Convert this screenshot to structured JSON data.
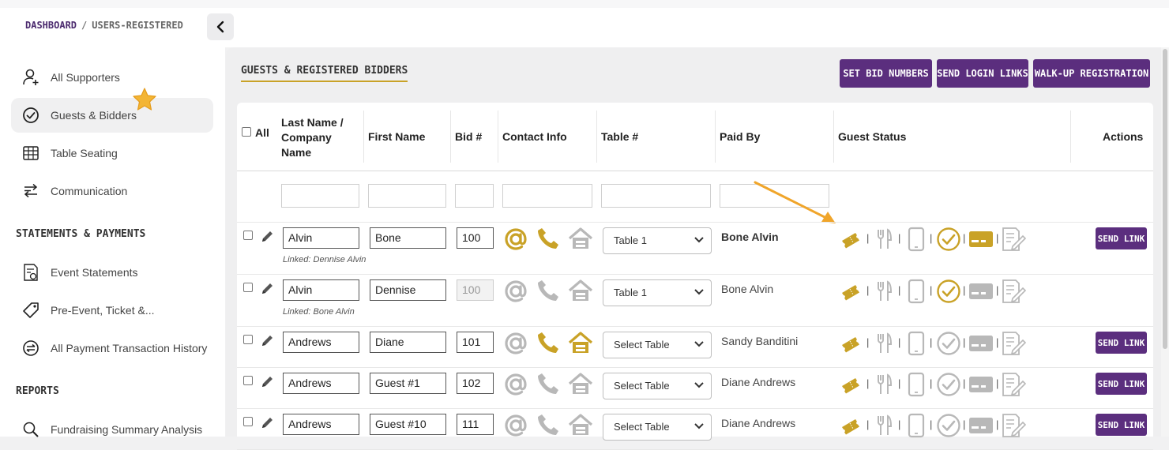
{
  "breadcrumb": {
    "home": "DASHBOARD",
    "separator": "/",
    "current": "USERS-REGISTERED"
  },
  "sidebar": {
    "items": [
      {
        "label": "All Supporters",
        "icon": "user-add-icon"
      },
      {
        "label": "Guests & Bidders",
        "icon": "check-circle-icon",
        "active": true
      },
      {
        "label": "Table Seating",
        "icon": "grid-icon"
      },
      {
        "label": "Communication",
        "icon": "arrows-icon"
      }
    ],
    "section_statements": "STATEMENTS & PAYMENTS",
    "statements_items": [
      {
        "label": "Event Statements",
        "icon": "statement-icon"
      },
      {
        "label": "Pre-Event, Ticket &...",
        "icon": "tag-icon"
      },
      {
        "label": "All Payment Transaction History",
        "icon": "exchange-icon"
      }
    ],
    "section_reports": "REPORTS",
    "reports_items": [
      {
        "label": "Fundraising Summary Analysis",
        "icon": "magnify-icon"
      }
    ]
  },
  "main": {
    "title": "GUESTS & REGISTERED BIDDERS",
    "buttons": {
      "set_bid": "SET BID NUMBERS",
      "send_login": "SEND LOGIN LINKS",
      "walk_up": "WALK-UP REGISTRATION"
    }
  },
  "table": {
    "headers": {
      "all": "All",
      "last_name": "Last Name / Company Name",
      "first_name": "First Name",
      "bid": "Bid #",
      "contact": "Contact Info",
      "table": "Table #",
      "paid_by": "Paid By",
      "guest_status": "Guest Status",
      "actions": "Actions"
    },
    "rows": [
      {
        "last": "Alvin",
        "first": "Bone",
        "bid": "100",
        "bid_disabled": false,
        "linked": "Linked: Dennise Alvin",
        "table": "Table 1",
        "paid_by": "Bone Alvin",
        "paid_bold": true,
        "email": true,
        "phone": true,
        "home": false,
        "checked_in": true,
        "card": true,
        "action": "SEND LINK"
      },
      {
        "last": "Alvin",
        "first": "Dennise",
        "bid": "100",
        "bid_disabled": true,
        "linked": "Linked: Bone Alvin",
        "table": "Table 1",
        "paid_by": "Bone Alvin",
        "paid_bold": false,
        "email": false,
        "phone": false,
        "home": false,
        "checked_in": true,
        "card": false,
        "action": ""
      },
      {
        "last": "Andrews",
        "first": "Diane",
        "bid": "101",
        "bid_disabled": false,
        "linked": "",
        "table": "Select Table",
        "paid_by": "Sandy Banditini",
        "paid_bold": false,
        "email": false,
        "phone": true,
        "home": true,
        "checked_in": false,
        "card": false,
        "action": "SEND LINK"
      },
      {
        "last": "Andrews",
        "first": "Guest #1",
        "bid": "102",
        "bid_disabled": false,
        "linked": "",
        "table": "Select Table",
        "paid_by": "Diane Andrews",
        "paid_bold": false,
        "email": false,
        "phone": false,
        "home": false,
        "checked_in": false,
        "card": false,
        "action": "SEND LINK"
      },
      {
        "last": "Andrews",
        "first": "Guest #10",
        "bid": "111",
        "bid_disabled": false,
        "linked": "",
        "table": "Select Table",
        "paid_by": "Diane Andrews",
        "paid_bold": false,
        "email": false,
        "phone": false,
        "home": false,
        "checked_in": false,
        "card": false,
        "action": "SEND LINK"
      }
    ]
  },
  "colors": {
    "gold": "#c9a227",
    "purple": "#5b2e7e",
    "gray_icon": "#b8b8b8",
    "arrow": "#f0a52a"
  }
}
